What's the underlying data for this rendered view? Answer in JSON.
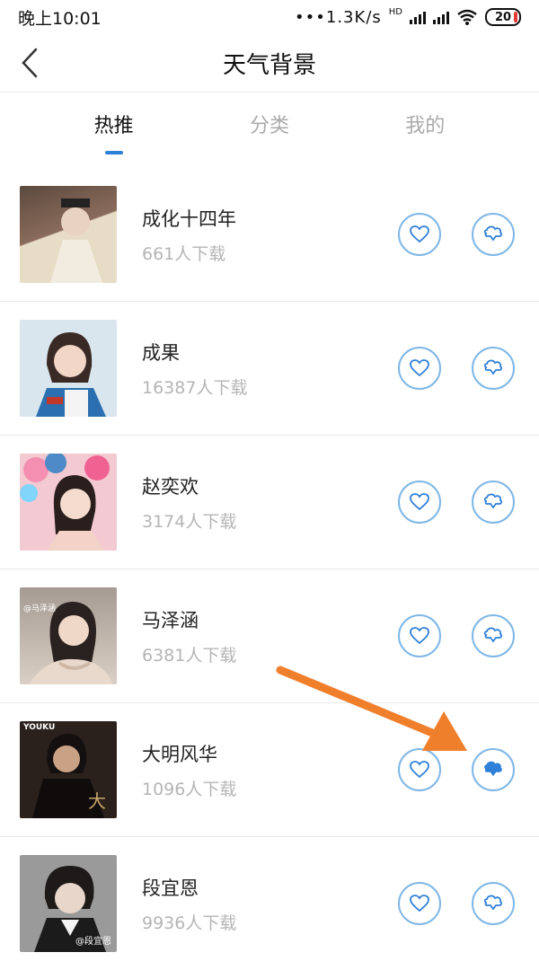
{
  "status": {
    "time": "晚上10:01",
    "net_speed": "•••1.3K/s",
    "hd_label": "HD",
    "battery": "20"
  },
  "header": {
    "title": "天气背景"
  },
  "tabs": [
    {
      "label": "热推",
      "active": true
    },
    {
      "label": "分类",
      "active": false
    },
    {
      "label": "我的",
      "active": false
    }
  ],
  "items": [
    {
      "name": "成化十四年",
      "downloads": "661人下载",
      "downloaded": false,
      "thumb_color": "#8a6b5a",
      "thumb_accent": "#e7dcc6"
    },
    {
      "name": "成果",
      "downloads": "16387人下载",
      "downloaded": false,
      "thumb_color": "#d9e6ee",
      "thumb_accent": "#2b6fb0"
    },
    {
      "name": "赵奕欢",
      "downloads": "3174人下载",
      "downloaded": false,
      "thumb_color": "#f3c9d2",
      "thumb_accent": "#4d8ac7"
    },
    {
      "name": "马泽涵",
      "downloads": "6381人下载",
      "downloaded": false,
      "thumb_color": "#cbbdb1",
      "thumb_accent": "#3a2f2b",
      "thumb_text": "@马泽涵"
    },
    {
      "name": "大明风华",
      "downloads": "1096人下载",
      "downloaded": true,
      "thumb_color": "#2b211c",
      "thumb_accent": "#c9a56b",
      "thumb_text": "YOUKU"
    },
    {
      "name": "段宜恩",
      "downloads": "9936人下载",
      "downloaded": false,
      "thumb_color": "#8d8d8d",
      "thumb_accent": "#f0f0f0",
      "thumb_text": "@段宜恩"
    }
  ],
  "icons": {
    "back": "chevron-left-icon",
    "favorite": "heart-icon",
    "download": "download-icon"
  },
  "colors": {
    "accent": "#2f80d8",
    "circle_border": "#7fb7e6",
    "annotation_arrow": "#f07f2c"
  }
}
